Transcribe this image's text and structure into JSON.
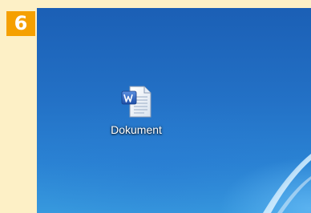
{
  "step": {
    "number": "6",
    "color": "#f5a000"
  },
  "desktop": {
    "background_color": "#2371c6",
    "icons": [
      {
        "label": "Dokument",
        "icon": "word-document-icon"
      }
    ]
  }
}
